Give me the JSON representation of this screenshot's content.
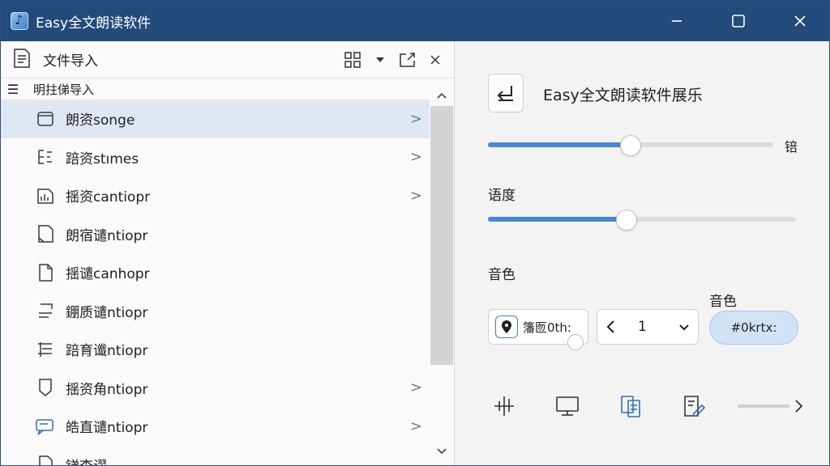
{
  "window": {
    "title": "Easy全文朗读软件",
    "accent": "#234b79"
  },
  "import_panel": {
    "title": "文件导入",
    "header_label": "明拄俤导入",
    "items": [
      {
        "label": "朗资songe",
        "icon": "folder-icon",
        "chevron": ">",
        "selected": true
      },
      {
        "label": "踣资stımes",
        "icon": "list-edit-icon",
        "chevron": ">"
      },
      {
        "label": "揺资cantiopr",
        "icon": "chart-doc-icon",
        "chevron": ">"
      },
      {
        "label": "朗宿谴ntiopr",
        "icon": "page-fold-icon",
        "chevron": ""
      },
      {
        "label": "揺谴canhopr",
        "icon": "page-icon",
        "chevron": ""
      },
      {
        "label": "錋质谴ntiopr",
        "icon": "lines-icon",
        "chevron": ""
      },
      {
        "label": "踣育谶ntiopr",
        "icon": "indent-icon",
        "chevron": ""
      },
      {
        "label": "揺资角ntiopr",
        "icon": "shield-page-icon",
        "chevron": ">"
      },
      {
        "label": "皓直谴ntiopr",
        "icon": "chat-icon",
        "chevron": ">"
      },
      {
        "label": "锑查谬",
        "icon": "page-icon",
        "chevron": ""
      }
    ]
  },
  "settings_panel": {
    "title": "Easy全文朗读软件展乐",
    "volume_side_label": "锫",
    "volume_value": 0.5,
    "rate_label": "语度",
    "rate_value": 0.45,
    "tone_label": "音色",
    "tone_label_secondary": "音色",
    "voice_value": "籓匢0th:",
    "number_value": "1",
    "action_button": "#0krtx:",
    "bottom_tools": [
      "crop-icon",
      "monitor-icon",
      "copy-doc-icon",
      "edit-doc-icon"
    ]
  }
}
